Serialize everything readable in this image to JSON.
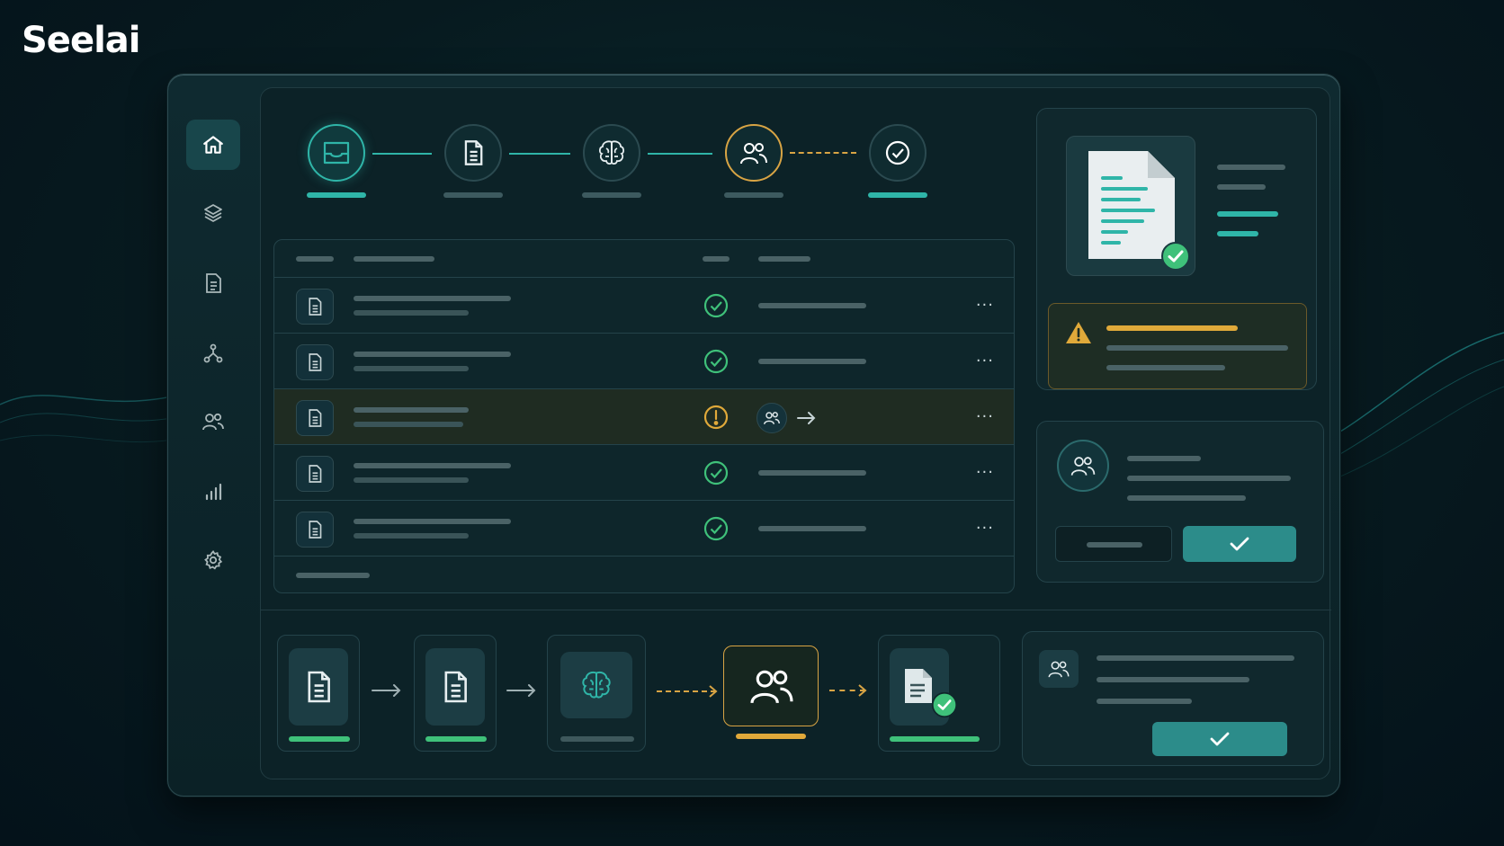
{
  "brand": {
    "name": "Seelai"
  },
  "colors": {
    "accent": "#2fb5a8",
    "success": "#3fc17a",
    "warning": "#e0a93a",
    "background": "#071a1f"
  },
  "sidebar": {
    "items": [
      {
        "icon": "home-icon",
        "active": true
      },
      {
        "icon": "layers-icon",
        "active": false
      },
      {
        "icon": "document-icon",
        "active": false
      },
      {
        "icon": "workflow-icon",
        "active": false
      },
      {
        "icon": "users-icon",
        "active": false
      },
      {
        "icon": "analytics-icon",
        "active": false
      },
      {
        "icon": "settings-icon",
        "active": false
      }
    ]
  },
  "pipeline": {
    "steps": [
      {
        "icon": "inbox-icon",
        "state": "done"
      },
      {
        "icon": "document-icon",
        "state": "done"
      },
      {
        "icon": "brain-icon",
        "state": "done"
      },
      {
        "icon": "users-icon",
        "state": "review"
      },
      {
        "icon": "check-circle-icon",
        "state": "pending"
      }
    ]
  },
  "table": {
    "rows": [
      {
        "status": "success",
        "icons": [
          "document-icon",
          "check-circle-icon",
          "more-icon"
        ]
      },
      {
        "status": "success",
        "icons": [
          "document-icon",
          "check-circle-icon",
          "more-icon"
        ]
      },
      {
        "status": "warning",
        "icons": [
          "document-icon",
          "alert-circle-icon",
          "users-icon",
          "arrow-right-icon",
          "more-icon"
        ]
      },
      {
        "status": "success",
        "icons": [
          "document-icon",
          "check-circle-icon",
          "more-icon"
        ]
      },
      {
        "status": "success",
        "icons": [
          "document-icon",
          "check-circle-icon",
          "more-icon"
        ]
      }
    ],
    "more_glyph": "···"
  },
  "preview_panel": {
    "icons": [
      "document-icon",
      "check-badge-icon",
      "warning-triangle-icon"
    ]
  },
  "review_panel": {
    "icons": [
      "users-icon",
      "check-icon"
    ]
  },
  "bottom_flow": {
    "cards": [
      {
        "icon": "document-icon",
        "status": "success"
      },
      {
        "icon": "document-icon",
        "status": "success"
      },
      {
        "icon": "brain-icon",
        "status": "neutral"
      },
      {
        "icon": "users-icon",
        "status": "warning"
      },
      {
        "icon": "document-check-icon",
        "status": "success"
      }
    ]
  },
  "approval_panel": {
    "icons": [
      "users-icon",
      "check-icon"
    ]
  }
}
